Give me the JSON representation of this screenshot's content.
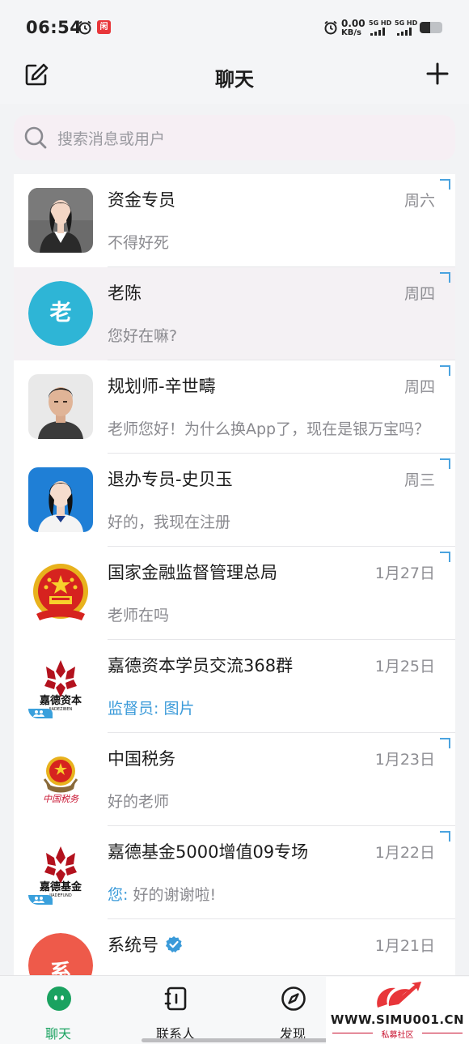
{
  "status_bar": {
    "time": "06:54",
    "speed_value": "0.00",
    "speed_unit": "KB/s",
    "network_1": "5G HD",
    "network_2": "5G HD",
    "app_badge": "闲"
  },
  "header": {
    "title": "聊天"
  },
  "search": {
    "placeholder": "搜索消息或用户"
  },
  "chats": [
    {
      "name": "资金专员",
      "time": "周六",
      "preview": "不得好死",
      "avatar": "photo-woman-vest"
    },
    {
      "name": "老陈",
      "time": "周四",
      "preview": "您好在嘛?",
      "avatar_letter": "老",
      "avatar_color": "#2eb5d6"
    },
    {
      "name": "规划师-辛世疇",
      "time": "周四",
      "preview": "老师您好！为什么换App了，现在是银万宝吗？",
      "avatar": "photo-man"
    },
    {
      "name": "退办专员-史贝玉",
      "time": "周三",
      "preview": "好的，我现在注册",
      "avatar": "photo-woman-blue"
    },
    {
      "name": "国家金融监督管理总局",
      "time": "1月27日",
      "preview": "老师在吗",
      "avatar": "national-emblem"
    },
    {
      "name": "嘉德资本学员交流368群",
      "time": "1月25日",
      "sender": "监督员:",
      "preview": "图片",
      "avatar": "logo-jiade-ziben",
      "logo_text": "嘉德资本",
      "logo_sub": "JIADEZIBEN"
    },
    {
      "name": "中国税务",
      "time": "1月23日",
      "preview": "好的老师",
      "avatar": "tax-emblem",
      "logo_text": "中国税务"
    },
    {
      "name": "嘉德基金5000增值09专场",
      "time": "1月22日",
      "sender": "您:",
      "preview": "好的谢谢啦!",
      "avatar": "logo-jiade-jijin",
      "logo_text": "嘉德基金",
      "logo_sub": "JIADEFUND"
    },
    {
      "name": "系统号",
      "time": "1月21日",
      "preview": "",
      "avatar_letter": "系",
      "avatar_color": "#ee5a4a",
      "verified": true
    }
  ],
  "tabs": [
    {
      "label": "聊天",
      "icon": "chat-bubble-icon",
      "active": true
    },
    {
      "label": "联系人",
      "icon": "contacts-book-icon",
      "active": false
    },
    {
      "label": "发现",
      "icon": "compass-icon",
      "active": false
    }
  ],
  "watermark": {
    "url": "WWW.SIMU001.CN",
    "subtitle": "私募社区"
  },
  "colors": {
    "accent_green": "#1aa260",
    "sender_blue": "#3a9ad9",
    "highlight_row": "#f4f1f4"
  }
}
